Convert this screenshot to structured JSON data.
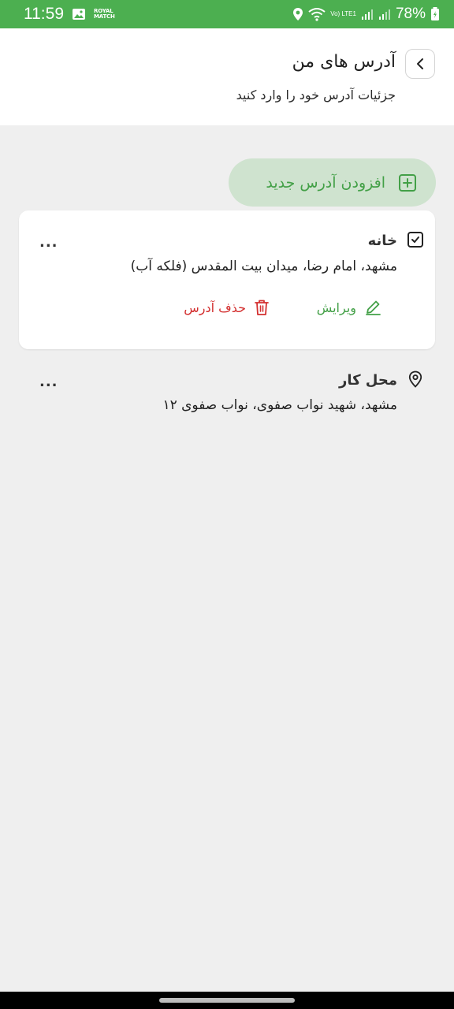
{
  "status_bar": {
    "time": "11:59",
    "royal_badge": "ROYAL MATCH",
    "network_label": "Vo) LTE1",
    "battery": "78%",
    "icons": [
      "gallery-icon",
      "location-icon",
      "wifi-icon",
      "signal-icon",
      "battery-charging-icon"
    ]
  },
  "header": {
    "title": "آدرس های من",
    "subtitle": "جزئیات آدرس خود را وارد کنید",
    "back_icon": "chevron-left-icon"
  },
  "add_button": {
    "label": "افزودن آدرس جدید",
    "icon": "plus-square-icon"
  },
  "addresses": [
    {
      "title": "خانه",
      "address": "مشهد، امام رضا، میدان بیت المقدس (فلکه آب)",
      "selected": true,
      "icon": "checkbox-checked-icon",
      "more": "...",
      "edit_label": "ویرایش",
      "delete_label": "حذف آدرس"
    },
    {
      "title": "محل کار",
      "address": "مشهد، شهید نواب صفوی، نواب صفوی ۱۲",
      "selected": false,
      "icon": "location-pin-icon",
      "more": "..."
    }
  ],
  "colors": {
    "status_bar": "#4caf50",
    "accent_green": "#43a047",
    "add_button_bg": "#cfe3cf",
    "delete_red": "#d32f2f",
    "page_bg": "#efefef"
  }
}
